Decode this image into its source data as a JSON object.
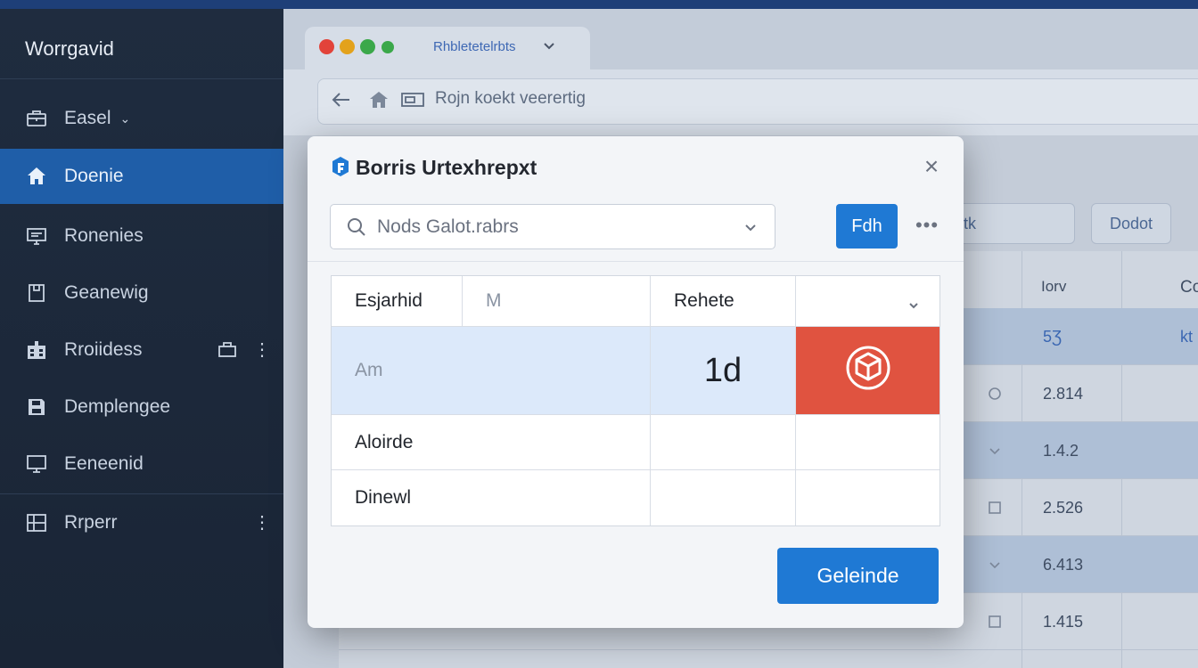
{
  "sidebar": {
    "app_title": "Worrgavid",
    "items": [
      {
        "label": "Easel",
        "icon": "briefcase-icon"
      },
      {
        "label": "Doenie",
        "icon": "home-icon"
      },
      {
        "label": "Ronenies",
        "icon": "monitor-icon"
      },
      {
        "label": "Geanewig",
        "icon": "page-icon"
      },
      {
        "label": "Rroiidess",
        "icon": "building-icon"
      },
      {
        "label": "Demplengee",
        "icon": "save-icon"
      },
      {
        "label": "Eeneenid",
        "icon": "display-icon"
      },
      {
        "label": "Rrperr",
        "icon": "grid-icon"
      }
    ]
  },
  "browser": {
    "tab_title": "Rhbletetelrbts",
    "address_text": "Rojn koekt veerertig",
    "accent_color": "#1f79d4"
  },
  "background_page": {
    "button_1": "tk",
    "button_2": "Dodot",
    "col_header_1": "Iorv",
    "col_header_2": "Co",
    "rows": [
      {
        "value": "5Ʒ",
        "right": "kt"
      },
      {
        "value": "2.814"
      },
      {
        "value": "1.4.2"
      },
      {
        "value": "2.526"
      },
      {
        "value": "6.413"
      },
      {
        "value": "1.415"
      }
    ]
  },
  "dialog": {
    "title": "Borris Urtexhrepxt",
    "search_placeholder": "Nods Galot.rabrs",
    "small_button": "Fdh",
    "more_label": "•••",
    "close_label": "×",
    "table": {
      "header": [
        "Esjarhid",
        "M",
        "Rehete",
        ""
      ],
      "rows": [
        {
          "c1": "Am",
          "c3": "1d"
        },
        {
          "c1": "Aloirde"
        },
        {
          "c1": "Dinewl"
        }
      ]
    },
    "primary_button": "Geleinde",
    "danger_color": "#e05340"
  }
}
